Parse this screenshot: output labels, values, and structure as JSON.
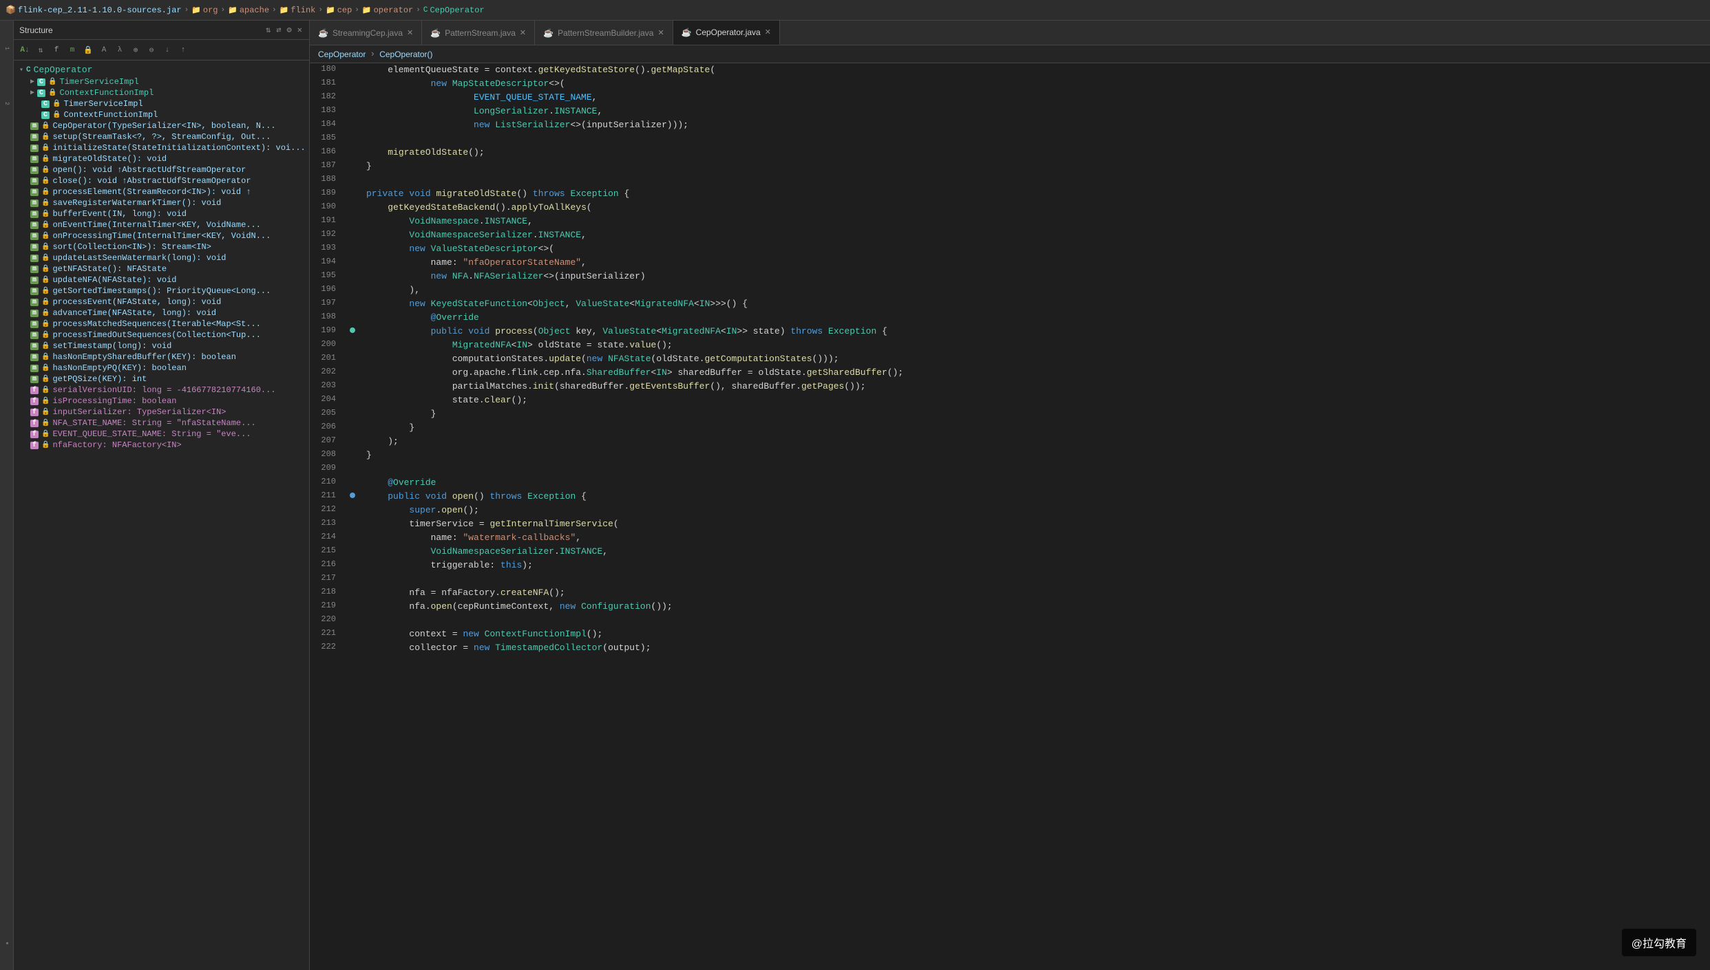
{
  "topbar": {
    "breadcrumbs": [
      {
        "label": "flink-cep_2.11-1.10.0-sources.jar",
        "type": "jar"
      },
      {
        "label": "org",
        "type": "package"
      },
      {
        "label": "apache",
        "type": "package"
      },
      {
        "label": "flink",
        "type": "package"
      },
      {
        "label": "cep",
        "type": "package"
      },
      {
        "label": "operator",
        "type": "package"
      },
      {
        "label": "CepOperator",
        "type": "class"
      }
    ]
  },
  "structure": {
    "title": "Structure",
    "root": "CepOperator",
    "items": [
      {
        "label": "TimerServiceImpl",
        "badge": "C",
        "indent": 1,
        "lock": true
      },
      {
        "label": "ContextFunctionImpl",
        "badge": "C",
        "indent": 1,
        "lock": true
      },
      {
        "label": "CepOperator(TypeSerializer<IN>, boolean, N...",
        "badge": "m",
        "indent": 0,
        "lock": true
      },
      {
        "label": "setup(StreamTask<?, ?>, StreamConfig, Out...",
        "badge": "m",
        "indent": 0,
        "lock": true
      },
      {
        "label": "initializeState(StateInitializationContext): voi...",
        "badge": "m",
        "indent": 0,
        "lock": true
      },
      {
        "label": "migrateOldState(): void",
        "badge": "m",
        "indent": 0,
        "lock": true
      },
      {
        "label": "open(): void ↑AbstractUdfStreamOperator",
        "badge": "m",
        "indent": 0,
        "lock": true
      },
      {
        "label": "close(): void ↑AbstractUdfStreamOperator",
        "badge": "m",
        "indent": 0,
        "lock": true
      },
      {
        "label": "processElement(StreamRecord<IN>): void ↑",
        "badge": "m",
        "indent": 0,
        "lock": true
      },
      {
        "label": "saveRegisterWatermarkTimer(): void",
        "badge": "m",
        "indent": 0,
        "lock": true
      },
      {
        "label": "bufferEvent(IN, long): void",
        "badge": "m",
        "indent": 0,
        "lock": true
      },
      {
        "label": "onEventTime(InternalTimer<KEY, VoidName...",
        "badge": "m",
        "indent": 0,
        "lock": true
      },
      {
        "label": "onProcessingTime(InternalTimer<KEY, VoidN...",
        "badge": "m",
        "indent": 0,
        "lock": true
      },
      {
        "label": "sort(Collection<IN>): Stream<IN>",
        "badge": "m",
        "indent": 0,
        "lock": true
      },
      {
        "label": "updateLastSeenWatermark(long): void",
        "badge": "m",
        "indent": 0,
        "lock": true
      },
      {
        "label": "getNFAState(): NFAState",
        "badge": "m",
        "indent": 0,
        "lock": true
      },
      {
        "label": "updateNFA(NFAState): void",
        "badge": "m",
        "indent": 0,
        "lock": true
      },
      {
        "label": "getSortedTimestamps(): PriorityQueue<Long...",
        "badge": "m",
        "indent": 0,
        "lock": true
      },
      {
        "label": "processEvent(NFAState, long): void",
        "badge": "m",
        "indent": 0,
        "lock": true
      },
      {
        "label": "advanceTime(NFAState, long): void",
        "badge": "m",
        "indent": 0,
        "lock": true
      },
      {
        "label": "processMatchedSequences(Iterable<Map<St...",
        "badge": "m",
        "indent": 0,
        "lock": true
      },
      {
        "label": "processTimedOutSequences(Collection<Tup...",
        "badge": "m",
        "indent": 0,
        "lock": true
      },
      {
        "label": "setTimestamp(long): void",
        "badge": "m",
        "indent": 0,
        "lock": true
      },
      {
        "label": "hasNonEmptySharedBuffer(KEY): boolean",
        "badge": "m",
        "indent": 0,
        "lock": true
      },
      {
        "label": "hasNonEmptyPQ(KEY): boolean",
        "badge": "m",
        "indent": 0,
        "lock": true
      },
      {
        "label": "getPQSize(KEY): int",
        "badge": "m",
        "indent": 0,
        "lock": true
      },
      {
        "label": "serialVersionUID: long = -4166778210774160...",
        "badge": "f",
        "indent": 0,
        "lock": true
      },
      {
        "label": "isProcessingTime: boolean",
        "badge": "f",
        "indent": 0,
        "lock": true
      },
      {
        "label": "inputSerializer: TypeSerializer<IN>",
        "badge": "f",
        "indent": 0,
        "lock": true
      },
      {
        "label": "NFA_STATE_NAME: String = \"nfaStateName...",
        "badge": "f",
        "indent": 0,
        "lock": true
      },
      {
        "label": "EVENT_QUEUE_STATE_NAME: String = \"eve...",
        "badge": "f",
        "indent": 0,
        "lock": true
      },
      {
        "label": "nfaFactory: NFAFactory<IN>",
        "badge": "f",
        "indent": 0,
        "lock": true
      }
    ]
  },
  "tabs": [
    {
      "label": "StreamingCep.java",
      "active": false,
      "closable": true
    },
    {
      "label": "PatternStream.java",
      "active": false,
      "closable": true
    },
    {
      "label": "PatternStreamBuilder.java",
      "active": false,
      "closable": true
    },
    {
      "label": "CepOperator.java",
      "active": true,
      "closable": true
    }
  ],
  "editor_breadcrumb": [
    "CepOperator",
    "CepOperator()"
  ],
  "lines": [
    {
      "num": 180,
      "gutter": "",
      "code": "    elementQueueState = context.getKeyedStateStore().getMapState("
    },
    {
      "num": 181,
      "gutter": "",
      "code": "            new MapStateDescriptor<>("
    },
    {
      "num": 182,
      "gutter": "",
      "code": "                    EVENT_QUEUE_STATE_NAME,",
      "special": "EVENT_QUEUE_STATE_NAME"
    },
    {
      "num": 183,
      "gutter": "",
      "code": "                    LongSerializer.INSTANCE,"
    },
    {
      "num": 184,
      "gutter": "",
      "code": "                    new ListSerializer<>(inputSerializer)));"
    },
    {
      "num": 185,
      "gutter": "",
      "code": ""
    },
    {
      "num": 186,
      "gutter": "",
      "code": "    migrateOldState();"
    },
    {
      "num": 187,
      "gutter": "",
      "code": "}"
    },
    {
      "num": 188,
      "gutter": "",
      "code": ""
    },
    {
      "num": 189,
      "gutter": "",
      "code": "private void migrateOldState() throws Exception {"
    },
    {
      "num": 190,
      "gutter": "",
      "code": "    getKeyedStateBackend().applyToAllKeys("
    },
    {
      "num": 191,
      "gutter": "",
      "code": "        VoidNamespace.INSTANCE,"
    },
    {
      "num": 192,
      "gutter": "",
      "code": "        VoidNamespaceSerializer.INSTANCE,"
    },
    {
      "num": 193,
      "gutter": "",
      "code": "        new ValueStateDescriptor<>("
    },
    {
      "num": 194,
      "gutter": "",
      "code": "            name: \"nfaOperatorStateName\",",
      "special": "nfaOperatorStateName"
    },
    {
      "num": 195,
      "gutter": "",
      "code": "            new NFA.NFASerializer<>(inputSerializer)"
    },
    {
      "num": 196,
      "gutter": "",
      "code": "        ),"
    },
    {
      "num": 197,
      "gutter": "",
      "code": "        new KeyedStateFunction<Object, ValueState<MigratedNFA<IN>>>() {"
    },
    {
      "num": 198,
      "gutter": "",
      "code": "            @Override"
    },
    {
      "num": 199,
      "gutter": "dot",
      "code": "            public void process(Object key, ValueState<MigratedNFA<IN>> state) throws Exception {"
    },
    {
      "num": 200,
      "gutter": "",
      "code": "                MigratedNFA<IN> oldState = state.value();"
    },
    {
      "num": 201,
      "gutter": "",
      "code": "                computationStates.update(new NFAState(oldState.getComputationStates()));"
    },
    {
      "num": 202,
      "gutter": "",
      "code": "                org.apache.flink.cep.nfa.SharedBuffer<IN> sharedBuffer = oldState.getSharedBuffer();"
    },
    {
      "num": 203,
      "gutter": "",
      "code": "                partialMatches.init(sharedBuffer.getEventsBuffer(), sharedBuffer.getPages());"
    },
    {
      "num": 204,
      "gutter": "",
      "code": "                state.clear();"
    },
    {
      "num": 205,
      "gutter": "",
      "code": "            }"
    },
    {
      "num": 206,
      "gutter": "",
      "code": "        }"
    },
    {
      "num": 207,
      "gutter": "",
      "code": "    );"
    },
    {
      "num": 208,
      "gutter": "",
      "code": "}"
    },
    {
      "num": 209,
      "gutter": "",
      "code": ""
    },
    {
      "num": 210,
      "gutter": "",
      "code": "    @Override"
    },
    {
      "num": 211,
      "gutter": "dot2",
      "code": "    public void open() throws Exception {"
    },
    {
      "num": 212,
      "gutter": "",
      "code": "        super.open();"
    },
    {
      "num": 213,
      "gutter": "",
      "code": "        timerService = getInternalTimerService("
    },
    {
      "num": 214,
      "gutter": "",
      "code": "            name: \"watermark-callbacks\",",
      "special": "watermark-callbacks"
    },
    {
      "num": 215,
      "gutter": "",
      "code": "            VoidNamespaceSerializer.INSTANCE,"
    },
    {
      "num": 216,
      "gutter": "",
      "code": "            triggerable: this);"
    },
    {
      "num": 217,
      "gutter": "",
      "code": ""
    },
    {
      "num": 218,
      "gutter": "",
      "code": "        nfa = nfaFactory.createNFA();"
    },
    {
      "num": 219,
      "gutter": "",
      "code": "        nfa.open(cepRuntimeContext, new Configuration());"
    },
    {
      "num": 220,
      "gutter": "",
      "code": ""
    },
    {
      "num": 221,
      "gutter": "",
      "code": "        context = new ContextFunctionImpl();"
    },
    {
      "num": 222,
      "gutter": "",
      "code": "        collector = new TimestampedCollector(output);"
    }
  ],
  "watermark": "@拉勾教育"
}
